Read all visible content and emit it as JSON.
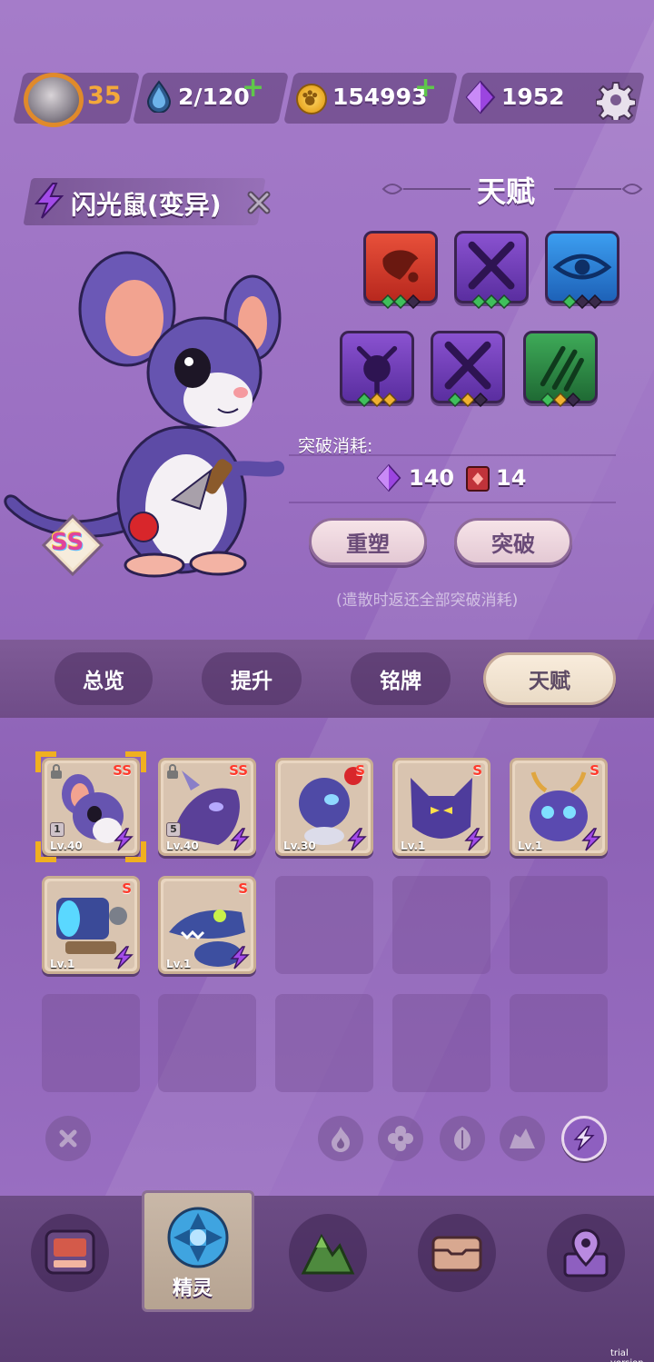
{
  "topbar": {
    "player_level": "35",
    "stamina": "2/120",
    "coins": "154993",
    "gems": "1952"
  },
  "creature": {
    "name": "闪光鼠(变异)",
    "rank": "SS"
  },
  "talent_panel": {
    "title": "天赋",
    "cost_label": "突破消耗:",
    "cost_gems": "140",
    "cost_items": "14",
    "reshape_button": "重塑",
    "breakthrough_button": "突破",
    "hint": "(遣散时返还全部突破消耗)"
  },
  "tabs": [
    "总览",
    "提升",
    "铭牌",
    "天赋"
  ],
  "roster": [
    {
      "rank": "SS",
      "level": "Lv.40",
      "stars": "1"
    },
    {
      "rank": "SS",
      "level": "Lv.40",
      "stars": "5"
    },
    {
      "rank": "S",
      "level": "Lv.30"
    },
    {
      "rank": "S",
      "level": "Lv.1"
    },
    {
      "rank": "S",
      "level": "Lv.1"
    },
    {
      "rank": "S",
      "level": "Lv.1"
    },
    {
      "rank": "S",
      "level": "Lv.1"
    }
  ],
  "bottom_nav": {
    "active_label": "精灵"
  },
  "watermark": "trial version",
  "colors": {
    "accent_orange": "#f3a83a",
    "plus_green": "#5fc84a",
    "rank_red": "#ff3a2c",
    "electric_purple": "#8e5fc0"
  },
  "icons": {
    "stamina": "water-drop-icon",
    "coins": "paw-coin-icon",
    "gems": "purple-gem-icon",
    "settings": "gear-icon",
    "element": "lightning-icon"
  }
}
